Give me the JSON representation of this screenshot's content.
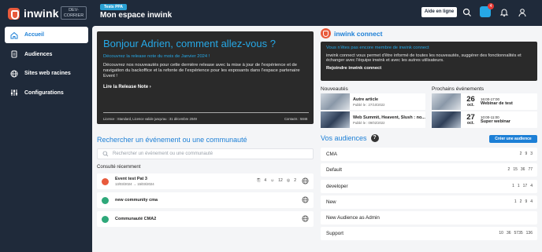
{
  "brand": {
    "name": "inwink",
    "env": "DEV-CORRIER"
  },
  "nav": [
    {
      "label": "Accueil",
      "icon": "home-icon"
    },
    {
      "label": "Audiences",
      "icon": "audience-icon"
    },
    {
      "label": "Sites web racines",
      "icon": "globe-icon"
    },
    {
      "label": "Configurations",
      "icon": "settings-sliders-icon"
    }
  ],
  "header": {
    "tag": "Tests PPA",
    "title": "Mon espace inwink",
    "help": "Aide en ligne",
    "notif_count": "4"
  },
  "hero": {
    "title": "Bonjour Adrien, comment allez-vous ?",
    "subtitle": "Découvrez la release note du mois de Janvier 2024 !",
    "text": "Découvrez nos nouveautés pour cette dernière release avec la mise à jour de l'expérience et de navigation du backoffice et la refonte de l'expérience pour les exposants dans l'espace partenaire Event !",
    "link": "Lire la Release Note ›",
    "licence": "Licence : Standard, Licence valide jusqu'au : 31 décembre 2049",
    "contacts": "Contacts : 5846"
  },
  "connect": {
    "title": "inwink connect",
    "box_title": "Vous n'êtes pas encore membre de inwink connect",
    "box_text": "inwink connect vous permet d'être informé de toutes les nouveautés, suggérer des fonctionnalités et échanger avec l'équipe inwink et avec les autres utilisateurs.",
    "box_link": "Rejoindre inwink connect"
  },
  "news": {
    "label": "Nouveautés",
    "items": [
      {
        "title": "Autre article",
        "date": "Publié le : 27/10/2022"
      },
      {
        "title": "Web Summit, Heavent, Slush : no...",
        "date": "Publié le : 09/02/2022"
      }
    ]
  },
  "events": {
    "label": "Prochains événements",
    "items": [
      {
        "day": "26",
        "month": "oct.",
        "time": "16:00-17:00",
        "name": "Webinar de test"
      },
      {
        "day": "27",
        "month": "oct.",
        "time": "10:00-11:00",
        "name": "Super webinar"
      }
    ]
  },
  "search": {
    "title": "Rechercher un événement ou une communauté",
    "placeholder": "Rechercher un événement ou une communauté",
    "recent_label": "Consulté récemment"
  },
  "recent": [
    {
      "name": "Event test Pat 3",
      "date": "13/03/2024 → 15/03/2024",
      "stats": [
        "4",
        "12",
        "2"
      ],
      "color": "#e85a3c"
    },
    {
      "name": "new community cma",
      "date": "",
      "stats": [],
      "color": "#2ea87a"
    },
    {
      "name": "Communauté CMA2",
      "date": "",
      "stats": [],
      "color": "#2ea87a"
    }
  ],
  "audiences": {
    "title": "Vos audiences",
    "create": "Créer une audience",
    "items": [
      {
        "name": "CMA",
        "stats": [
          "2",
          "9",
          "3"
        ]
      },
      {
        "name": "Default",
        "stats": [
          "2",
          "15",
          "36",
          "77"
        ]
      },
      {
        "name": "developer",
        "stats": [
          "1",
          "1",
          "17",
          "4"
        ]
      },
      {
        "name": "New",
        "stats": [
          "1",
          "2",
          "9",
          "4"
        ]
      },
      {
        "name": "New Audience as Admin",
        "stats": []
      },
      {
        "name": "Support",
        "stats": [
          "10",
          "36",
          "5735",
          "136"
        ]
      }
    ]
  }
}
